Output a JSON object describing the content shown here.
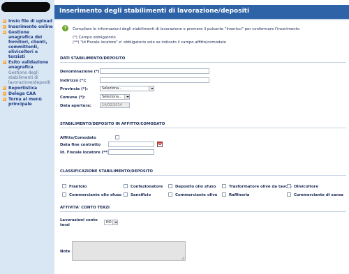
{
  "sidebar": {
    "items": [
      {
        "label": "Invio file di upload",
        "type": "main"
      },
      {
        "label": "Inserimento online",
        "type": "main"
      },
      {
        "label": "Gestione anagrafica dei fornitori, clienti, committenti, olivicoltori e terzisti",
        "type": "main"
      },
      {
        "label": "Esito validazione anagrafica",
        "type": "main"
      },
      {
        "label": "Gestione degli stabilimenti di lavorazione/depositi",
        "type": "sub"
      },
      {
        "label": "Reportistica",
        "type": "main"
      },
      {
        "label": "Delega CAA",
        "type": "main"
      },
      {
        "label": "Torna al menù principale",
        "type": "main"
      }
    ]
  },
  "page": {
    "title": "Inserimento degli stabilimenti di lavorazione/depositi",
    "info": "Compilare le informazioni degli stabilimenti di lavorazione e premere il pulsante \"Inserisci\" per confermare l'inserimento",
    "note1": "(*) Campo obbligatorio",
    "note2": "(**) \"Id Fiscale locatore\" e' obbligatorio solo se indicato il campo affitto/comodato"
  },
  "dati": {
    "section": "DATI STABILIMENTO/DEPOSITO",
    "denominazione_label": "Denominazione (*):",
    "denominazione_value": "",
    "indirizzo_label": "Indirizzo (*):",
    "indirizzo_value": "",
    "provincia_label": "Provincia (*):",
    "provincia_value": "Seleziona...",
    "comune_label": "Comune (*):",
    "comune_value": "Seleziona...",
    "apertura_label": "Data apertura:",
    "apertura_value": "14/02/2014"
  },
  "affitto": {
    "section": "STABILIMENTO/DEPOSITO IN AFFITTO/COMODATO",
    "comodato_label": "Affitto/Comodato",
    "comodato_checked": false,
    "fine_label": "Data fine contratto",
    "fine_value": "",
    "idfiscale_label": "Id. Fiscale locatore (**)",
    "idfiscale_value": ""
  },
  "classificazione": {
    "section": "CLASSIFICAZIONE STABILIMENTO/DEPOSITO",
    "options": [
      "Frantoio",
      "Confezionatore",
      "Deposito olio sfuso",
      "Trasformatore olive da tavola",
      "Olivicoltore",
      "Commerciante olio sfuso",
      "Sansificio",
      "Commerciante olive",
      "Raffineria",
      "Commerciante di sansa"
    ]
  },
  "terzi": {
    "section": "ATTIVITA' CONTO TERZI",
    "lavorazioni_label": "Lavorazioni conto terzi",
    "lavorazioni_value": "NO"
  },
  "note": {
    "label": "Note",
    "value": ""
  },
  "colors": {
    "title_bar": "#2f63a8",
    "sidebar": "#d9e6f3",
    "nav_text": "#1d3d86",
    "bullet": "#f2a63a",
    "info_icon": "#6ea62a"
  }
}
